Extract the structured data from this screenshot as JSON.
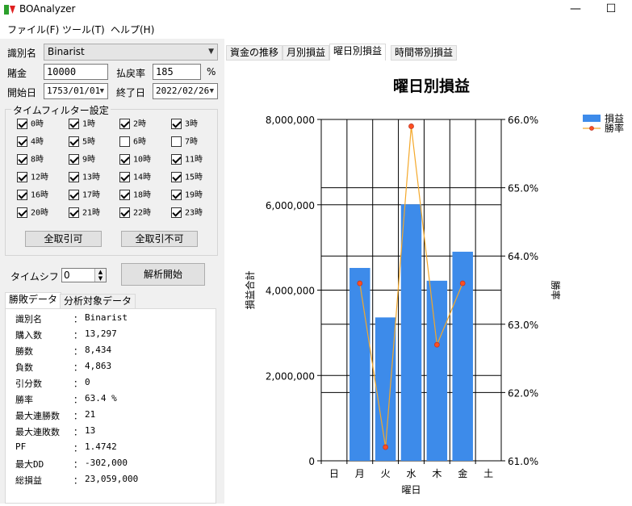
{
  "window": {
    "title": "BOAnalyzer",
    "minimize": "—",
    "maximize": "☐"
  },
  "menu": [
    "ファイル(F)",
    "ツール(T)",
    "ヘルプ(H)"
  ],
  "form": {
    "identifier_label": "識別名",
    "identifier_value": "Binarist",
    "stake_label": "賭金",
    "stake_value": "10000",
    "payout_label": "払戻率",
    "payout_value": "185",
    "payout_unit": "%",
    "start_label": "開始日",
    "start_value": "1753/01/01",
    "end_label": "終了日",
    "end_value": "2022/02/26"
  },
  "time_filter": {
    "title": "タイムフィルター設定",
    "hours": [
      {
        "label": "0時",
        "checked": true
      },
      {
        "label": "1時",
        "checked": true
      },
      {
        "label": "2時",
        "checked": true
      },
      {
        "label": "3時",
        "checked": true
      },
      {
        "label": "4時",
        "checked": true
      },
      {
        "label": "5時",
        "checked": true
      },
      {
        "label": "6時",
        "checked": false
      },
      {
        "label": "7時",
        "checked": false
      },
      {
        "label": "8時",
        "checked": true
      },
      {
        "label": "9時",
        "checked": true
      },
      {
        "label": "10時",
        "checked": true
      },
      {
        "label": "11時",
        "checked": true
      },
      {
        "label": "12時",
        "checked": true
      },
      {
        "label": "13時",
        "checked": true
      },
      {
        "label": "14時",
        "checked": true
      },
      {
        "label": "15時",
        "checked": true
      },
      {
        "label": "16時",
        "checked": true
      },
      {
        "label": "17時",
        "checked": true
      },
      {
        "label": "18時",
        "checked": true
      },
      {
        "label": "19時",
        "checked": true
      },
      {
        "label": "20時",
        "checked": true
      },
      {
        "label": "21時",
        "checked": true
      },
      {
        "label": "22時",
        "checked": true
      },
      {
        "label": "23時",
        "checked": true
      }
    ],
    "allow_all": "全取引可",
    "deny_all": "全取引不可"
  },
  "time_shift": {
    "label": "タイムシフト",
    "value": "0"
  },
  "analyze_button": "解析開始",
  "left_tabs": [
    "勝敗データ",
    "分析対象データ"
  ],
  "results": [
    {
      "key": "識別名",
      "value": "Binarist"
    },
    {
      "key": "購入数",
      "value": "13,297"
    },
    {
      "key": "勝数",
      "value": "8,434"
    },
    {
      "key": "負数",
      "value": "4,863"
    },
    {
      "key": "引分数",
      "value": "0"
    },
    {
      "key": "勝率",
      "value": "63.4 %"
    },
    {
      "key": "最大連勝数",
      "value": "21"
    },
    {
      "key": "最大連敗数",
      "value": "13"
    },
    {
      "key": "PF",
      "value": "1.4742"
    },
    {
      "key": "最大DD",
      "value": "-302,000"
    },
    {
      "key": "総損益",
      "value": "23,059,000"
    }
  ],
  "colon": "：",
  "right_tabs": [
    "資金の推移",
    "月別損益",
    "曜日別損益",
    "時間帯別損益"
  ],
  "colors": {
    "bar": "#3d8bea",
    "line": "#f4a82a",
    "marker": "#ff4f1f",
    "marker_stroke": "#c0392b"
  },
  "chart_data": {
    "type": "bar",
    "title": "曜日別損益",
    "categories": [
      "日",
      "月",
      "火",
      "水",
      "木",
      "金",
      "土"
    ],
    "series": [
      {
        "name": "損益",
        "type": "bar",
        "axis": "left",
        "values": [
          0,
          4520000,
          3360000,
          6010000,
          4220000,
          4900000,
          0
        ]
      },
      {
        "name": "勝率",
        "type": "line",
        "axis": "right",
        "values": [
          null,
          63.6,
          61.2,
          65.9,
          62.7,
          63.6,
          null
        ]
      }
    ],
    "xlabel": "曜日",
    "ylabel": "損益合計",
    "y2label": "勝率",
    "ylim": [
      0,
      8000000
    ],
    "y2lim": [
      61.0,
      66.0
    ],
    "yticks": [
      "0",
      "2,000,000",
      "4,000,000",
      "6,000,000",
      "8,000,000"
    ],
    "y2ticks": [
      "61.0%",
      "62.0%",
      "63.0%",
      "64.0%",
      "65.0%",
      "66.0%"
    ],
    "legend_position": "top-right"
  }
}
